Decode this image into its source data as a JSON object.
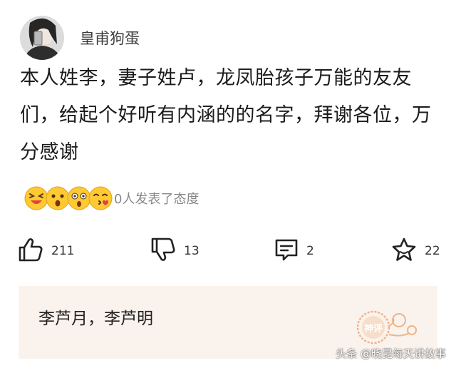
{
  "post": {
    "username": "皇甫狗蛋",
    "text": "本人姓李，妻子姓卢，龙凤胎孩子万能的友友们，给起个好听有内涵的的名字，拜谢各位，万分感谢"
  },
  "reactions": {
    "summary": "0人发表了态度",
    "emojis": [
      "laughing-emoji",
      "surprised-emoji",
      "shocked-emoji",
      "kissing-emoji"
    ]
  },
  "actions": {
    "like_count": "211",
    "dislike_count": "13",
    "comment_count": "2",
    "favorite_count": "22"
  },
  "comment": {
    "text": "李芦月，李芦明",
    "stamp_label": "神评"
  },
  "watermark": "头条 @晓昆每天讲故事",
  "colors": {
    "comment_bg": "#faf2ec",
    "stamp": "#f0b48a",
    "emoji_yellow": "#ffc933"
  }
}
